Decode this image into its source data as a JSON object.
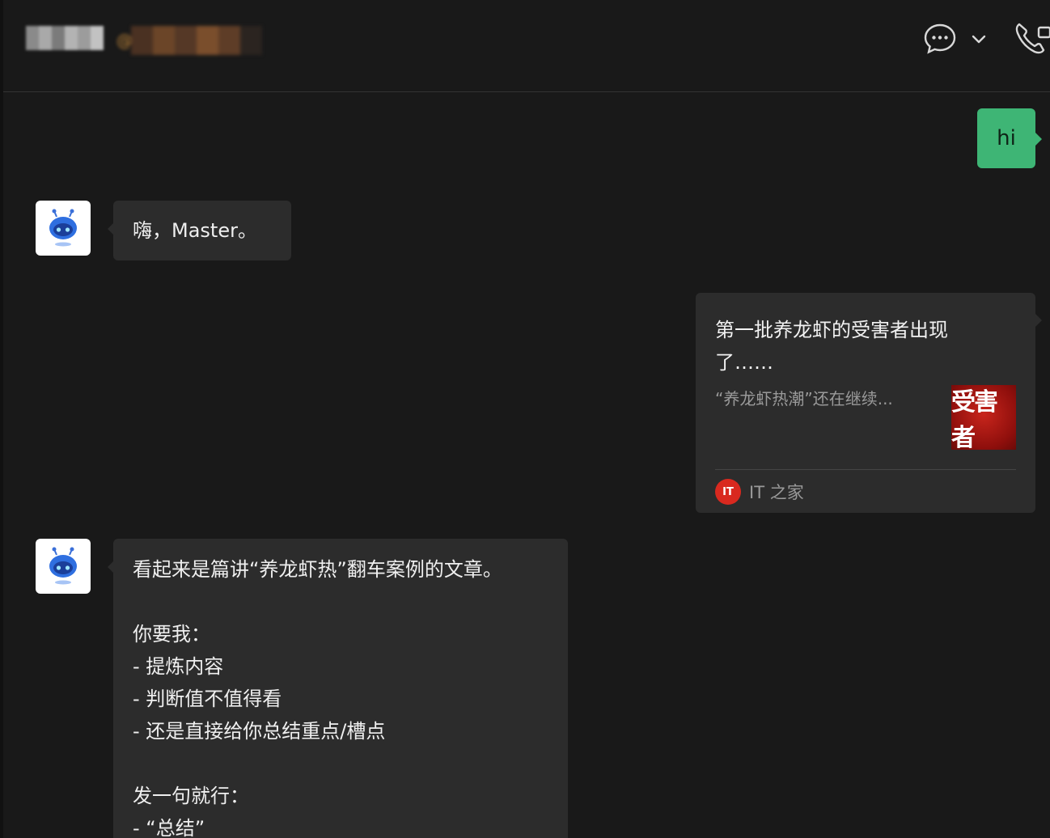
{
  "header": {
    "contact_name_blurred": true,
    "contact_handle_prefix": "@",
    "icons": [
      "chat-icon",
      "chevron-down-icon",
      "phone-video-icon"
    ]
  },
  "messages": [
    {
      "type": "outgoing",
      "text": "hi"
    },
    {
      "type": "incoming",
      "sender": "bot",
      "text": "嗨，Master。"
    },
    {
      "type": "outgoing-card",
      "title": "第一批养龙虾的受害者出现了……",
      "description": "“养龙虾热潮”还在继续...",
      "thumb_text": "受害者",
      "source_logo": "IT",
      "source_name": "IT 之家"
    },
    {
      "type": "incoming",
      "sender": "bot",
      "lines": [
        "看起来是篇讲“养龙虾热”翻车案例的文章。",
        "",
        "你要我：",
        "- 提炼内容",
        "- 判断值不值得看",
        "- 还是直接给你总结重点/槽点",
        "",
        "发一句就行：",
        "- “总结”"
      ]
    }
  ],
  "colors": {
    "background": "#191919",
    "incoming_bubble": "#2c2c2c",
    "outgoing_bubble": "#3eb575",
    "source_logo": "#d9291f"
  }
}
